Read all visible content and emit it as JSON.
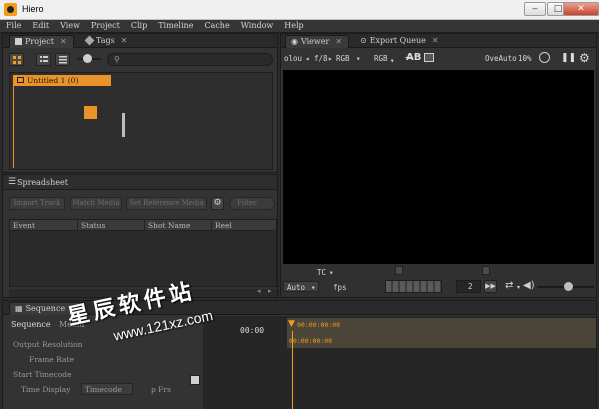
{
  "window": {
    "title": "Hiero",
    "minimize": "‒",
    "maximize": "□",
    "close": "✕"
  },
  "menu": [
    "File",
    "Edit",
    "View",
    "Project",
    "Clip",
    "Timeline",
    "Cache",
    "Window",
    "Help"
  ],
  "project_panel": {
    "tabs": [
      {
        "label": "Project",
        "close": "✕"
      },
      {
        "label": "Tags",
        "close": "✕"
      }
    ],
    "bin_item": "Untitled 1 (0)"
  },
  "spreadsheet_panel": {
    "title": "Spreadsheet",
    "buttons": {
      "import_track": "Import Track",
      "match_media": "Match Media",
      "set_reference_media": "Set Reference Media",
      "filter": "Filter"
    },
    "columns": [
      "Event",
      "Status",
      "Shot Name",
      "Reel"
    ]
  },
  "viewer_panel": {
    "tabs": [
      {
        "label": "Viewer",
        "close": "✕"
      },
      {
        "label": "Export Queue",
        "close": "✕"
      }
    ],
    "toolbar": {
      "channels": "olou",
      "fstop": "f/8",
      "colorspace": "RGB",
      "display": "RGB",
      "overlay": "OveAuto",
      "zoom": "10%"
    },
    "timecode_mode": "TC",
    "fps_value": "Auto",
    "fps_label": "fps",
    "frame_step": "2"
  },
  "sequence_panel": {
    "tab": {
      "label": "Sequence",
      "close": "✕"
    },
    "header": {
      "sequence_label": "Sequence",
      "media_label": "Media"
    },
    "timecode_left": "00:00",
    "timecode_playhead": "00:00:00:00",
    "timecode_ruler": "00:00:00:00",
    "fields": [
      "Output Resolution",
      "Frame Rate",
      "Start Timecode",
      "Time Display",
      "Drop Frame"
    ],
    "time_display_value": "Timecode",
    "drop_label": "p Frs"
  },
  "watermark": {
    "cn": "星辰软件站",
    "url": "www.121xz.com"
  },
  "colors": {
    "accent": "#f39c1e",
    "selection": "#e8942a",
    "viewer_bg": "#000000",
    "panel_bg": "#333333"
  }
}
